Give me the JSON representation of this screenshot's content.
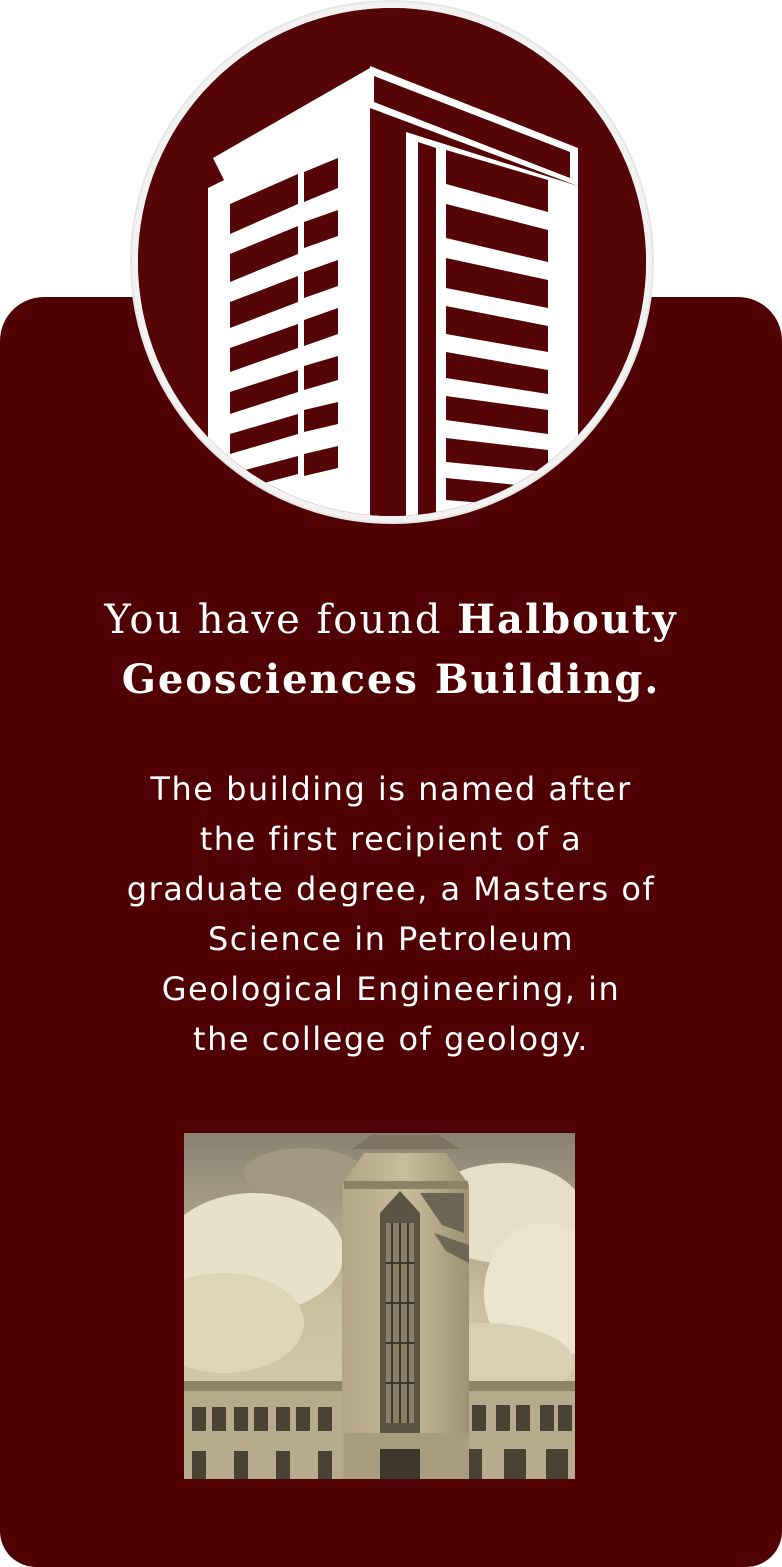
{
  "badge": {
    "icon": "building-tower-icon"
  },
  "heading": {
    "lead": "You have found",
    "bold_line1": "Halbouty",
    "bold_line2": "Geosciences Building."
  },
  "description": {
    "lines": [
      "The building is named after",
      "the first recipient of a",
      "graduate degree, a Masters of",
      "Science in Petroleum",
      "Geological Engineering, in",
      "the college of geology."
    ]
  },
  "photo": {
    "subject": "historic-building-photo"
  },
  "colors": {
    "maroon": "#500003",
    "white": "#ffffff",
    "sepia": "#cfc2a4"
  }
}
